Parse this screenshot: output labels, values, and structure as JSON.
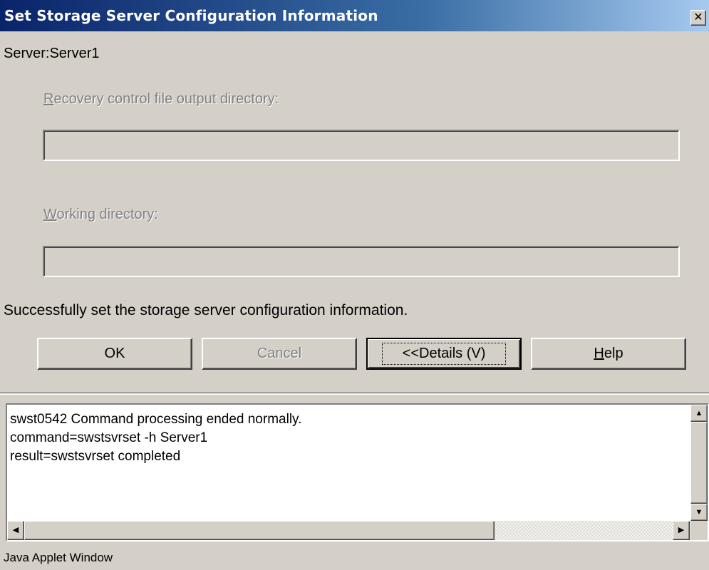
{
  "window": {
    "title": "Set Storage Server Configuration Information",
    "close_glyph": "✕"
  },
  "dialog": {
    "server_label": "Server:Server1",
    "recovery_label_mnemonic": "R",
    "recovery_label_rest": "ecovery control file output directory:",
    "recovery_value": "",
    "working_label_mnemonic": "W",
    "working_label_rest": "orking directory:",
    "working_value": "",
    "status_message": "Successfully set the storage server configuration information."
  },
  "buttons": {
    "ok": "OK",
    "cancel": "Cancel",
    "details": "<<Details (V)",
    "help_mnemonic": "H",
    "help_rest": "elp"
  },
  "details": {
    "lines": [
      "swst0542 Command processing ended normally.",
      "command=swstsvrset -h Server1",
      "result=swstsvrset completed"
    ]
  },
  "footer": {
    "text": "Java Applet Window"
  },
  "icons": {
    "scroll_up": "▲",
    "scroll_down": "▼",
    "scroll_left": "◀",
    "scroll_right": "▶"
  }
}
